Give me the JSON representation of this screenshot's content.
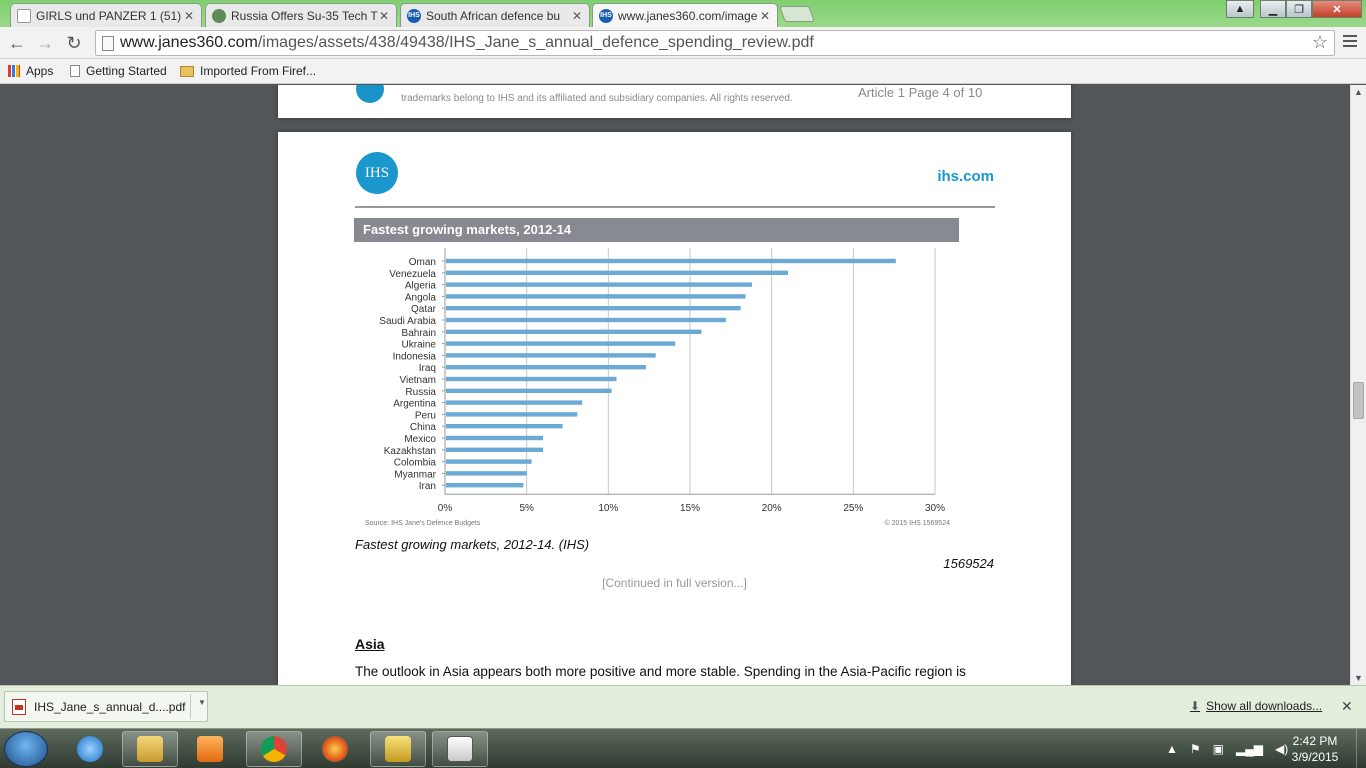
{
  "browser": {
    "tabs": [
      {
        "title": "GIRLS und PANZER 1 (51)",
        "favicon": "page-icon",
        "active": false
      },
      {
        "title": "Russia Offers Su-35 Tech T",
        "favicon": "site-icon",
        "active": false
      },
      {
        "title": "South African defence bu",
        "favicon": "ihs-icon",
        "active": false
      },
      {
        "title": "www.janes360.com/image",
        "favicon": "ihs-icon",
        "active": true
      }
    ],
    "url_host": "www.janes360.com",
    "url_path": "/images/assets/438/49438/IHS_Jane_s_annual_defence_spending_review.pdf",
    "bookmarks": [
      "Apps",
      "Getting Started",
      "Imported From Firef..."
    ]
  },
  "pdf": {
    "prev_page_footer": "trademarks belong to IHS and its affiliated and subsidiary companies. All rights reserved.",
    "prev_page_footer_right": "Article 1 Page 4 of 10",
    "logo_text": "IHS",
    "site": "ihs.com",
    "caption": "Fastest growing markets, 2012-14. (IHS)",
    "figure_id": "1569524",
    "continued": "[Continued in full version...]",
    "section_heading": "Asia",
    "body_text": "The outlook in Asia appears both more positive and more stable. Spending in the Asia-Pacific region is"
  },
  "chart_data": {
    "type": "bar",
    "orientation": "horizontal",
    "title": "Fastest growing markets, 2012-14",
    "categories": [
      "Oman",
      "Venezuela",
      "Algeria",
      "Angola",
      "Qatar",
      "Saudi Arabia",
      "Bahrain",
      "Ukraine",
      "Indonesia",
      "Iraq",
      "Vietnam",
      "Russia",
      "Argentina",
      "Peru",
      "China",
      "Mexico",
      "Kazakhstan",
      "Colombia",
      "Myanmar",
      "Iran"
    ],
    "values": [
      27.6,
      21.0,
      18.8,
      18.4,
      18.1,
      17.2,
      15.7,
      14.1,
      12.9,
      12.3,
      10.5,
      10.2,
      8.4,
      8.1,
      7.2,
      6.0,
      6.0,
      5.3,
      5.0,
      4.8
    ],
    "xlim": [
      0,
      30
    ],
    "xticks": [
      "0%",
      "5%",
      "10%",
      "15%",
      "20%",
      "25%",
      "30%"
    ],
    "grid": true,
    "bar_color": "#6aaad4",
    "source": "Source: IHS Jane's Defence Budgets",
    "copyright": "© 2015 IHS  1569524"
  },
  "downloads": {
    "file": "IHS_Jane_s_annual_d....pdf",
    "show_all": "Show all downloads..."
  },
  "taskbar": {
    "apps": [
      "internet-explorer-icon",
      "file-explorer-icon",
      "media-player-icon",
      "chrome-icon",
      "firefox-icon",
      "paint-app-icon",
      "calendar-app-icon"
    ],
    "time": "2:42 PM",
    "date": "3/9/2015"
  }
}
